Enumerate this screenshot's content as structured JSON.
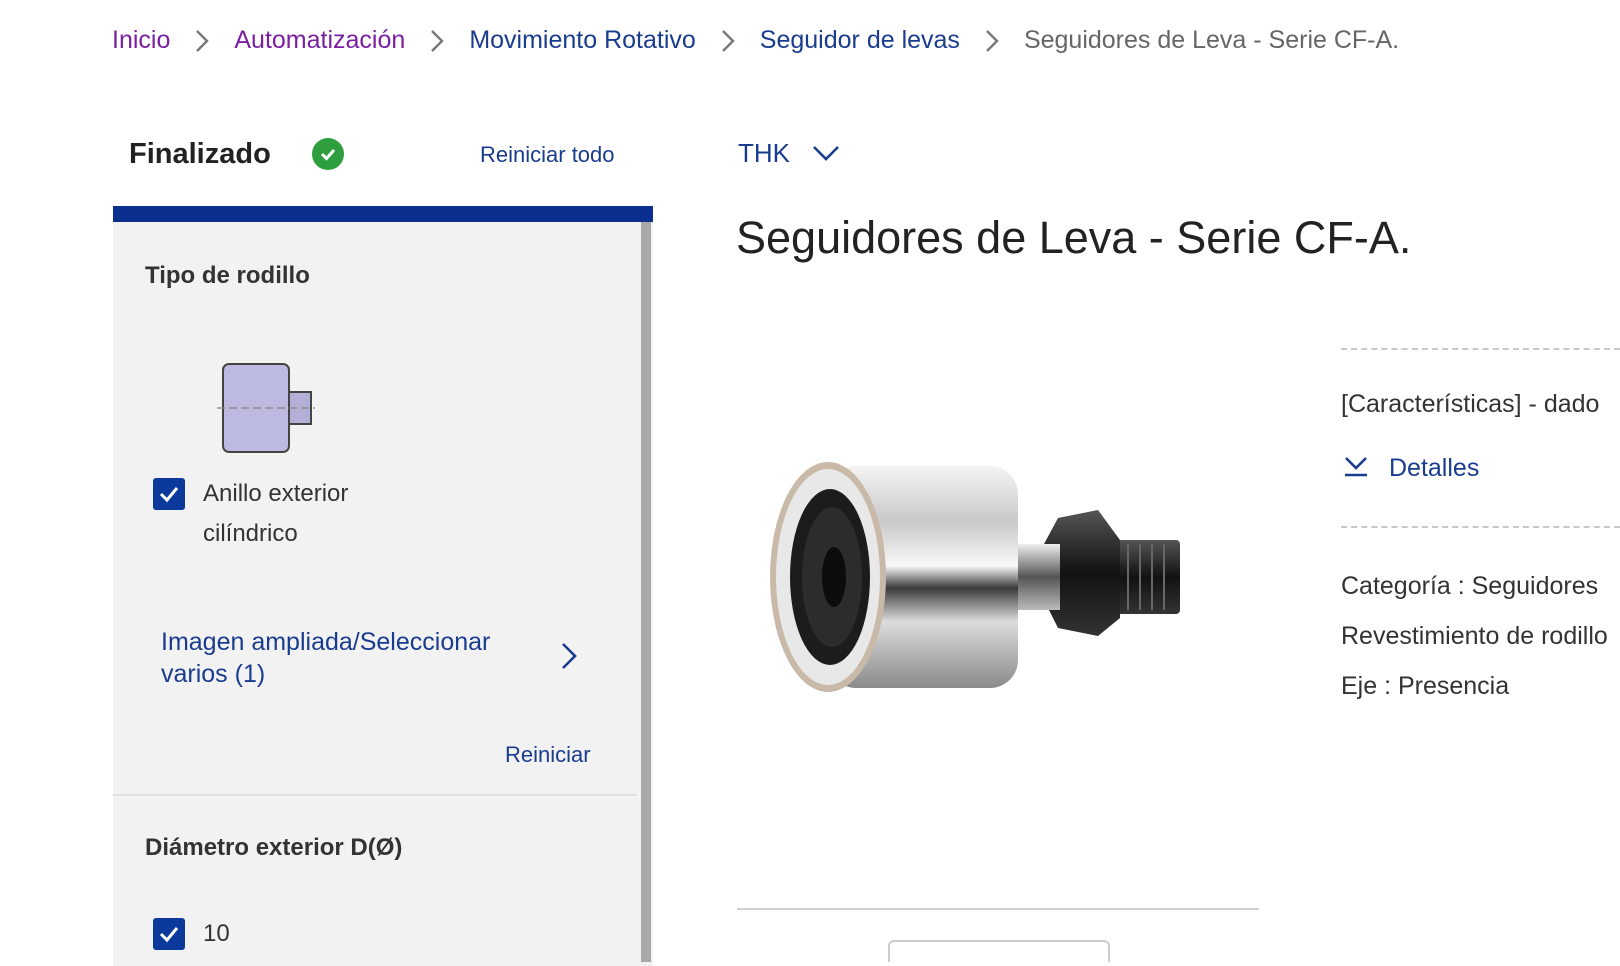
{
  "breadcrumb": {
    "items": [
      "Inicio",
      "Automatización",
      "Movimiento Rotativo",
      "Seguidor de levas"
    ],
    "current": "Seguidores de Leva - Serie CF-A."
  },
  "filters": {
    "status": "Finalizado",
    "reset_all": "Reiniciar todo",
    "roller_type": {
      "title": "Tipo de rodillo",
      "option_line1": "Anillo exterior",
      "option_line2": "cilíndrico",
      "option_checked": true,
      "enlarge_line1": "Imagen ampliada/Seleccionar",
      "enlarge_line2": "varios (1)",
      "reset": "Reiniciar"
    },
    "outer_diameter": {
      "title": "Diámetro exterior D(Ø)",
      "option": "10",
      "option_checked": true
    }
  },
  "product": {
    "brand": "THK",
    "title": "Seguidores de Leva - Serie CF-A.",
    "features": "[Características] - dado",
    "details": "Detalles",
    "specs": [
      "Categoría : Seguidores",
      "Revestimiento de rodillo",
      "Eje : Presencia"
    ]
  },
  "colors": {
    "link": "#1a3c8f",
    "visited": "#7a1fa2",
    "accent_bar": "#0a2f8f",
    "checkbox": "#0b3a9c",
    "success": "#2e9e3f",
    "sidebar_bg": "#f2f2f2"
  },
  "icons": [
    "chevron-right-icon",
    "check-circle-icon",
    "chevron-down-icon",
    "checkbox-check-icon",
    "download-arrow-icon"
  ]
}
